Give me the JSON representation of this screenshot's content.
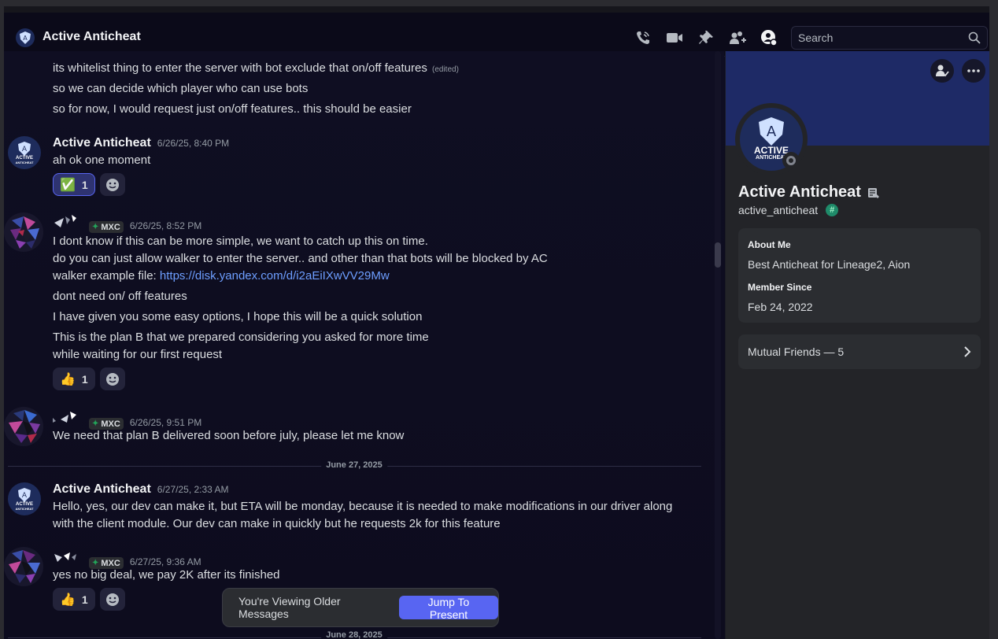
{
  "header": {
    "channel_title": "Active Anticheat",
    "search_placeholder": "Search",
    "icons": [
      "phone-call-icon",
      "video-call-icon",
      "pin-icon",
      "add-friend-icon",
      "user-profile-icon",
      "search-icon"
    ]
  },
  "messages": {
    "m0": {
      "line1": "its whitelist thing to enter the server with bot exclude that on/off features",
      "edited": "(edited)",
      "line2": "so we can decide which player who can use bots",
      "line3": "so for now, I would request just on/off features.. this should be easier"
    },
    "m1": {
      "author": "Active Anticheat",
      "time": "6/26/25, 8:40 PM",
      "text": "ah ok one moment",
      "reaction": {
        "emoji": "✅",
        "count": "1"
      }
    },
    "m2": {
      "tag": "MXC",
      "time": "6/26/25, 8:52 PM",
      "line1": "I dont know if this can be more simple, we want to catch up this on time.",
      "line2": "do you can just allow walker to enter the server.. and other than that bots will be blocked by AC",
      "line3_prefix": "walker example file: ",
      "line3_link": "https://disk.yandex.com/d/i2aEiIXwVV29Mw",
      "line4": "dont need on/ off features",
      "line5": "I have given you some easy options, I hope this will be a quick solution",
      "line6": "This is the plan B that we prepared considering you asked for more time",
      "line7": "while waiting for our first request",
      "reaction": {
        "emoji": "👍",
        "count": "1"
      }
    },
    "m3": {
      "tag": "MXC",
      "time": "6/26/25, 9:51 PM",
      "text": "We need that plan B delivered soon before july, please let me know"
    },
    "divider1": "June 27, 2025",
    "m4": {
      "author": "Active Anticheat",
      "time": "6/27/25, 2:33 AM",
      "line1": "Hello, yes, our dev can make it, but ETA will be monday, because it is needed to make modifications in our driver along",
      "line2": "with the client module. Our dev can make in quickly but he requests 2k for this feature"
    },
    "m5": {
      "tag": "MXC",
      "time": "6/27/25, 9:36 AM",
      "text": "yes no big deal, we pay 2K after its finished",
      "reaction": {
        "emoji": "👍",
        "count": "1"
      }
    },
    "divider2": "June 28, 2025"
  },
  "older_bar": {
    "text": "You're Viewing Older Messages",
    "button": "Jump To Present"
  },
  "profile": {
    "avatar_line1": "ACTIVE",
    "avatar_line2": "ANTICHEAT",
    "display_name": "Active Anticheat",
    "username": "active_anticheat",
    "badge": "#",
    "about_label": "About Me",
    "about_text": "Best Anticheat for Lineage2, Aion",
    "member_since_label": "Member Since",
    "member_since": "Feb 24, 2022",
    "mutual_friends": "Mutual Friends — 5"
  },
  "colors": {
    "accent": "#5865f2",
    "background": "#0d0c1e",
    "banner": "#1e2a66",
    "panel": "#232428"
  }
}
